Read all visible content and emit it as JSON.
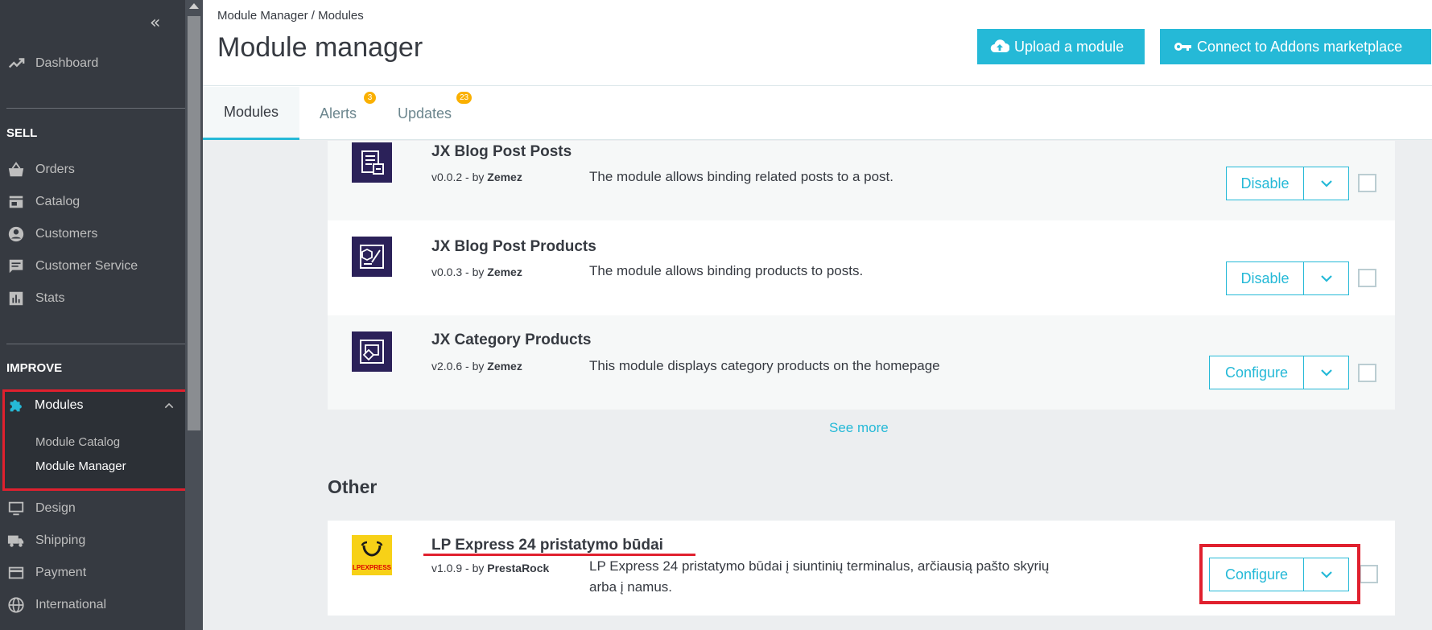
{
  "sidebar": {
    "collapse_glyph": "«",
    "dashboard": "Dashboard",
    "sections": {
      "sell": "SELL",
      "improve": "IMPROVE"
    },
    "sell_items": [
      "Orders",
      "Catalog",
      "Customers",
      "Customer Service",
      "Stats"
    ],
    "modules": {
      "label": "Modules",
      "sub": [
        "Module Catalog",
        "Module Manager"
      ]
    },
    "improve_items": [
      "Design",
      "Shipping",
      "Payment",
      "International"
    ]
  },
  "header": {
    "breadcrumb": "Module Manager  /  Modules",
    "title": "Module manager",
    "upload_btn": "Upload a module",
    "connect_btn": "Connect to Addons marketplace"
  },
  "tabs": [
    {
      "label": "Modules"
    },
    {
      "label": "Alerts",
      "badge": "3"
    },
    {
      "label": "Updates",
      "badge": "23"
    }
  ],
  "modules": [
    {
      "name": "JX Blog Post Posts",
      "version": "v0.0.2 - by ",
      "author": "Zemez",
      "description": "The module allows binding related posts to a post.",
      "action": "Disable"
    },
    {
      "name": "JX Blog Post Products",
      "version": "v0.0.3 - by ",
      "author": "Zemez",
      "description": "The module allows binding products to posts.",
      "action": "Disable"
    },
    {
      "name": "JX Category Products",
      "version": "v2.0.6 - by ",
      "author": "Zemez",
      "description": "This module displays category products on the homepage",
      "action": "Configure"
    }
  ],
  "see_more": "See more",
  "other": {
    "title": "Other",
    "module": {
      "name": "LP Express 24 pristatymo būdai",
      "version": "v1.0.9 - by ",
      "author": "PrestaRock",
      "description_line1": "LP Express 24 pristatymo būdai į siuntinių terminalus, arčiausią pašto skyrių",
      "description_line2": "arba į namus.",
      "action": "Configure",
      "logo_text": "LPEXPRESS"
    }
  },
  "colors": {
    "accent": "#25b9d7",
    "sidebar": "#363a41",
    "highlight": "#e0202e",
    "badge": "#fab000"
  }
}
